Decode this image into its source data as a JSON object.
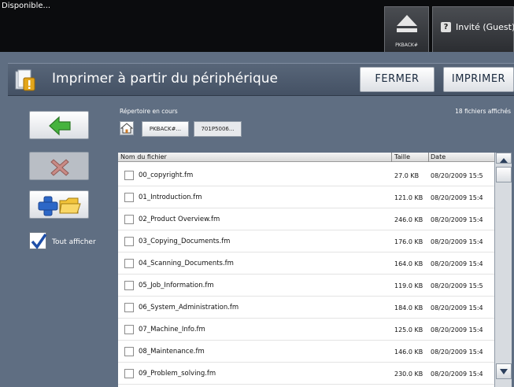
{
  "status": {
    "text": "Disponible..."
  },
  "usb": {
    "label": "PKBACK#",
    "icon": "eject-icon"
  },
  "guest": {
    "label": "Invité (Guest)",
    "icon_glyph": "?"
  },
  "title": {
    "text": "Imprimer à partir du périphérique"
  },
  "buttons": {
    "close": "FERMER",
    "print": "IMPRIMER"
  },
  "directory": {
    "label": "Répertoire en cours",
    "count_text": "18 fichiers affichés",
    "path": [
      "PKBACK#...",
      "701P5006..."
    ]
  },
  "show_all": {
    "label": "Tout afficher",
    "checked": true
  },
  "table": {
    "headers": {
      "name": "Nom du fichier",
      "size": "Taille",
      "date": "Date"
    },
    "rows": [
      {
        "name": "00_copyright.fm",
        "size": "27.0 KB",
        "date": "08/20/2009 15:5"
      },
      {
        "name": "01_Introduction.fm",
        "size": "121.0 KB",
        "date": "08/20/2009 15:4"
      },
      {
        "name": "02_Product Overview.fm",
        "size": "246.0 KB",
        "date": "08/20/2009 15:4"
      },
      {
        "name": "03_Copying_Documents.fm",
        "size": "176.0 KB",
        "date": "08/20/2009 15:4"
      },
      {
        "name": "04_Scanning_Documents.fm",
        "size": "164.0 KB",
        "date": "08/20/2009 15:4"
      },
      {
        "name": "05_Job_Information.fm",
        "size": "119.0 KB",
        "date": "08/20/2009 15:5"
      },
      {
        "name": "06_System_Administration.fm",
        "size": "184.0 KB",
        "date": "08/20/2009 15:4"
      },
      {
        "name": "07_Machine_Info.fm",
        "size": "125.0 KB",
        "date": "08/20/2009 15:4"
      },
      {
        "name": "08_Maintenance.fm",
        "size": "146.0 KB",
        "date": "08/20/2009 15:4"
      },
      {
        "name": "09_Problem_solving.fm",
        "size": "230.0 KB",
        "date": "08/20/2009 15:4"
      }
    ]
  },
  "colors": {
    "accent_green": "#3fae3a",
    "accent_red": "#c0392b",
    "accent_blue": "#2b62c9",
    "background": "#5f6e82"
  }
}
